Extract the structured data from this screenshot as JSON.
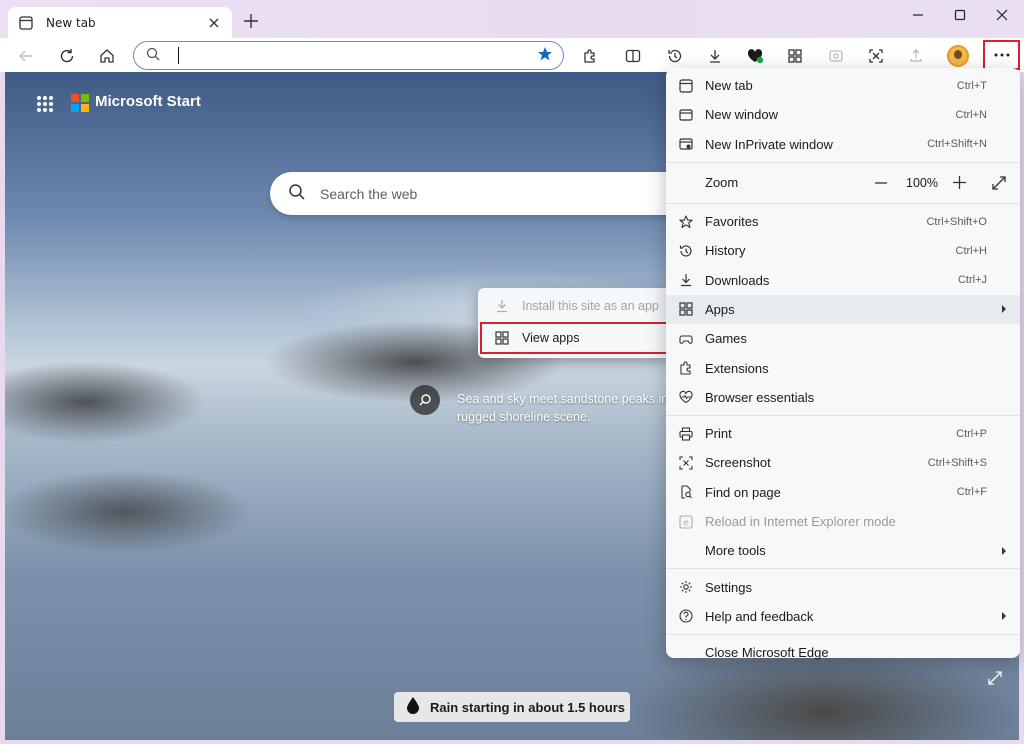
{
  "tab": {
    "title": "New tab"
  },
  "toolbar": {
    "address_value": ""
  },
  "page": {
    "brand": "Microsoft Start",
    "search_placeholder": "Search the web",
    "caption_line1": "Sea and sky meet sandstone peaks in",
    "caption_line2": "rugged shoreline scene.",
    "weather": "Rain starting in about 1.5 hours"
  },
  "apps_submenu": {
    "items": [
      {
        "label": "Install this site as an app",
        "disabled": true,
        "icon": "download-icon"
      },
      {
        "label": "View apps",
        "disabled": false,
        "icon": "apps-grid-icon"
      }
    ]
  },
  "menu": {
    "new_tab": {
      "label": "New tab",
      "shortcut": "Ctrl+T"
    },
    "new_window": {
      "label": "New window",
      "shortcut": "Ctrl+N"
    },
    "new_inprivate": {
      "label": "New InPrivate window",
      "shortcut": "Ctrl+Shift+N"
    },
    "zoom": {
      "label": "Zoom",
      "value": "100%"
    },
    "favorites": {
      "label": "Favorites",
      "shortcut": "Ctrl+Shift+O"
    },
    "history": {
      "label": "History",
      "shortcut": "Ctrl+H"
    },
    "downloads": {
      "label": "Downloads",
      "shortcut": "Ctrl+J"
    },
    "apps": {
      "label": "Apps"
    },
    "games": {
      "label": "Games"
    },
    "extensions": {
      "label": "Extensions"
    },
    "browser_essentials": {
      "label": "Browser essentials"
    },
    "print": {
      "label": "Print",
      "shortcut": "Ctrl+P"
    },
    "screenshot": {
      "label": "Screenshot",
      "shortcut": "Ctrl+Shift+S"
    },
    "find": {
      "label": "Find on page",
      "shortcut": "Ctrl+F"
    },
    "reload_ie": {
      "label": "Reload in Internet Explorer mode"
    },
    "more_tools": {
      "label": "More tools"
    },
    "settings": {
      "label": "Settings"
    },
    "help": {
      "label": "Help and feedback"
    },
    "close": {
      "label": "Close Microsoft Edge"
    }
  },
  "colors": {
    "highlight_border": "#d8202f",
    "accent_blue": "#0f6cbd"
  }
}
